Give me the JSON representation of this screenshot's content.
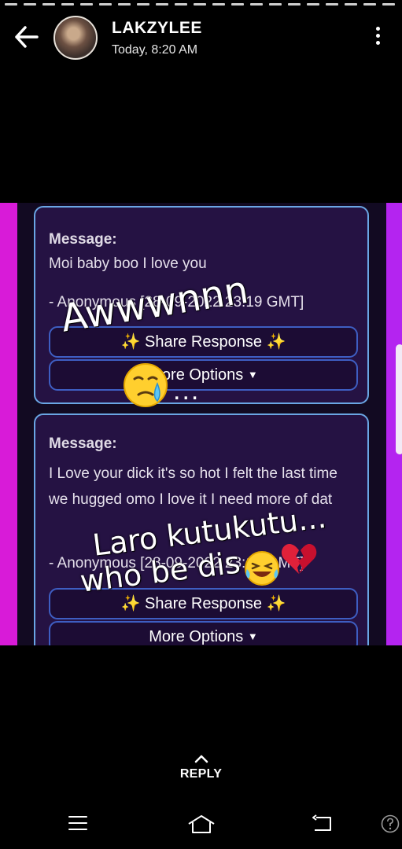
{
  "status": {
    "title": "LAKZYLEE",
    "timestamp": "Today, 8:20 AM",
    "icons": {
      "back": "arrow-left-icon",
      "menu": "more-vertical-icon"
    }
  },
  "page": {
    "cards": [
      {
        "label": "Message:",
        "text": "Moi baby boo I love you",
        "signature": "- Anonymous [28-09-2022 23:19 GMT]",
        "share_label": "✨ Share Response ✨",
        "more_label": "More Options"
      },
      {
        "label": "Message:",
        "text": "I Love your dick it's so hot I felt the last time we hugged omo I love it I need more of dat",
        "signature": "- Anonymous [28-09-2022 23:19 GMT]",
        "share_label": "✨ Share Response ✨",
        "more_label": "More Options"
      }
    ]
  },
  "overlays": {
    "text1": "Awwwnnn",
    "dots1": "...",
    "text2": "Laro kutukutu...",
    "text3": "who be dis"
  },
  "reply": {
    "label": "REPLY"
  },
  "colors": {
    "accent_left": "#d81bd8",
    "accent_right": "#b424f0",
    "card_border": "#6aa6e4",
    "button_border": "#3e5ec2"
  }
}
